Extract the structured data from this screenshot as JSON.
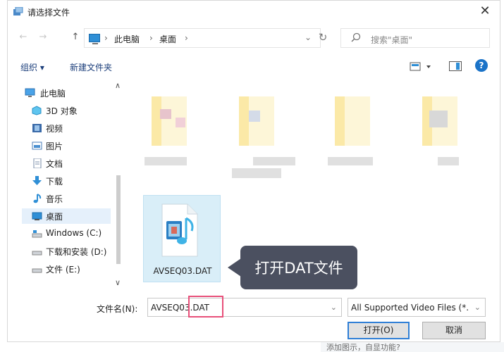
{
  "window": {
    "title": "请选择文件"
  },
  "address": {
    "crumbs": [
      "此电脑",
      "桌面"
    ],
    "separator": "›"
  },
  "search": {
    "placeholder": "搜索\"桌面\""
  },
  "toolbar": {
    "organize": "组织 ▾",
    "new_folder": "新建文件夹",
    "help": "?"
  },
  "nav": {
    "items": [
      {
        "label": "此电脑",
        "icon": "computer-icon"
      },
      {
        "label": "3D 对象",
        "icon": "cube-icon"
      },
      {
        "label": "视频",
        "icon": "video-icon"
      },
      {
        "label": "图片",
        "icon": "picture-icon"
      },
      {
        "label": "文档",
        "icon": "document-icon"
      },
      {
        "label": "下载",
        "icon": "download-icon"
      },
      {
        "label": "音乐",
        "icon": "music-icon"
      },
      {
        "label": "桌面",
        "icon": "desktop-icon"
      },
      {
        "label": "Windows (C:)",
        "icon": "drive-icon"
      },
      {
        "label": "下载和安装 (D:)",
        "icon": "drive-icon"
      },
      {
        "label": "文件 (E:)",
        "icon": "drive-icon"
      }
    ],
    "selected_index": 7
  },
  "files": {
    "selected_file": {
      "name": "AVSEQ03.DAT",
      "icon": "video-music-file-icon"
    }
  },
  "callout": {
    "text": "打开DAT文件",
    "color": "#4b5060"
  },
  "footer": {
    "filename_label": "文件名(N):",
    "filename_value": "AVSEQ03.DAT",
    "filetype_value": "All Supported Video Files (*.",
    "open_label": "打开(O)",
    "cancel_label": "取消"
  },
  "background": {
    "partial_text": "添加图示，自显功能?"
  },
  "colors": {
    "accent": "#2f7fd6",
    "selection": "#d9eef8",
    "highlight": "#e8507a"
  }
}
